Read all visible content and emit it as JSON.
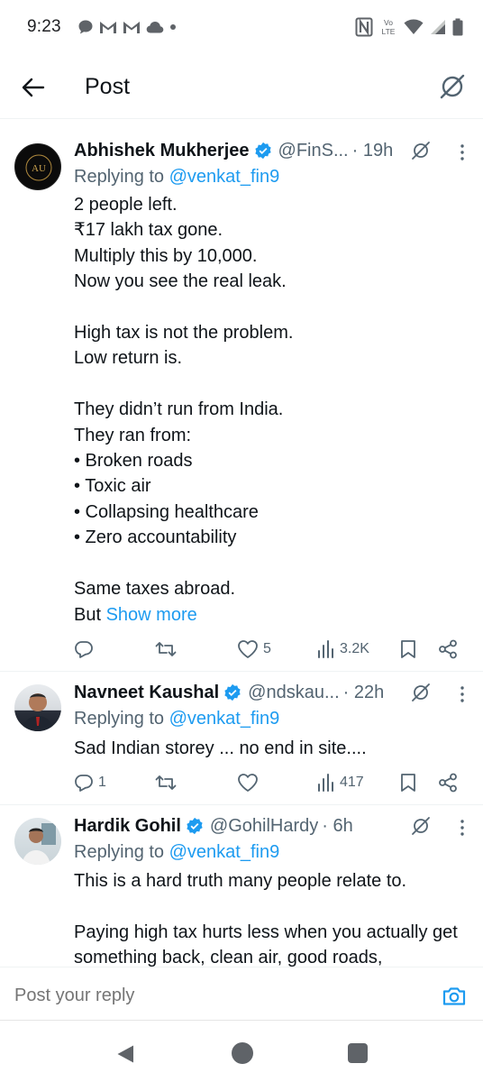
{
  "status_bar": {
    "time": "9:23",
    "notification_icons": [
      "chat-bubble-icon",
      "gmail-icon",
      "gmail-icon",
      "cloud-icon",
      "dot-icon"
    ],
    "right_icons": [
      "nfc-icon",
      "volte-icon",
      "wifi-icon",
      "signal-icon",
      "battery-icon"
    ],
    "volte_top": "Vo",
    "volte_bottom": "LTE"
  },
  "header": {
    "title": "Post",
    "back_icon": "arrow-left-icon",
    "grok_icon": "grok-icon"
  },
  "tweets": [
    {
      "name": "Abhishek Mukherjee",
      "handle": "@FinS...",
      "time": "· 19h",
      "replying_prefix": "Replying to ",
      "replying_to": "@venkat_fin9",
      "text": "2 people left.\n₹17 lakh tax gone.\nMultiply this by 10,000.\nNow you see the real leak.\n\nHigh tax is not the problem.\nLow return is.\n\nThey didn’t run from India.\nThey ran from:\n• Broken roads\n• Toxic air\n• Collapsing healthcare\n• Zero accountability\n\nSame taxes abroad.\nBut ",
      "show_more": "Show more",
      "avatar_initials": "AU",
      "replies": "",
      "reposts": "",
      "likes": "5",
      "views": "3.2K"
    },
    {
      "name": "Navneet Kaushal",
      "handle": "@ndskau...",
      "time": "· 22h",
      "replying_prefix": "Replying to ",
      "replying_to": "@venkat_fin9",
      "text": "Sad Indian storey ... no end in site....",
      "replies": "1",
      "reposts": "",
      "likes": "",
      "views": "417"
    },
    {
      "name": "Hardik Gohil",
      "handle": "@GohilHardy",
      "time": "· 6h",
      "replying_prefix": "Replying to ",
      "replying_to": "@venkat_fin9",
      "text": "This is a hard truth many people relate to.\n\nPaying high tax hurts less when you actually get something back, clean air, good roads,"
    }
  ],
  "reply_bar": {
    "placeholder": "Post your reply",
    "camera_icon": "camera-icon"
  },
  "nav_bar": {
    "icons": [
      "nav-back-icon",
      "nav-home-icon",
      "nav-recents-icon"
    ]
  },
  "colors": {
    "accent": "#1d9bf0",
    "text": "#0f1419",
    "secondary": "#536471",
    "divider": "#eff3f4"
  }
}
